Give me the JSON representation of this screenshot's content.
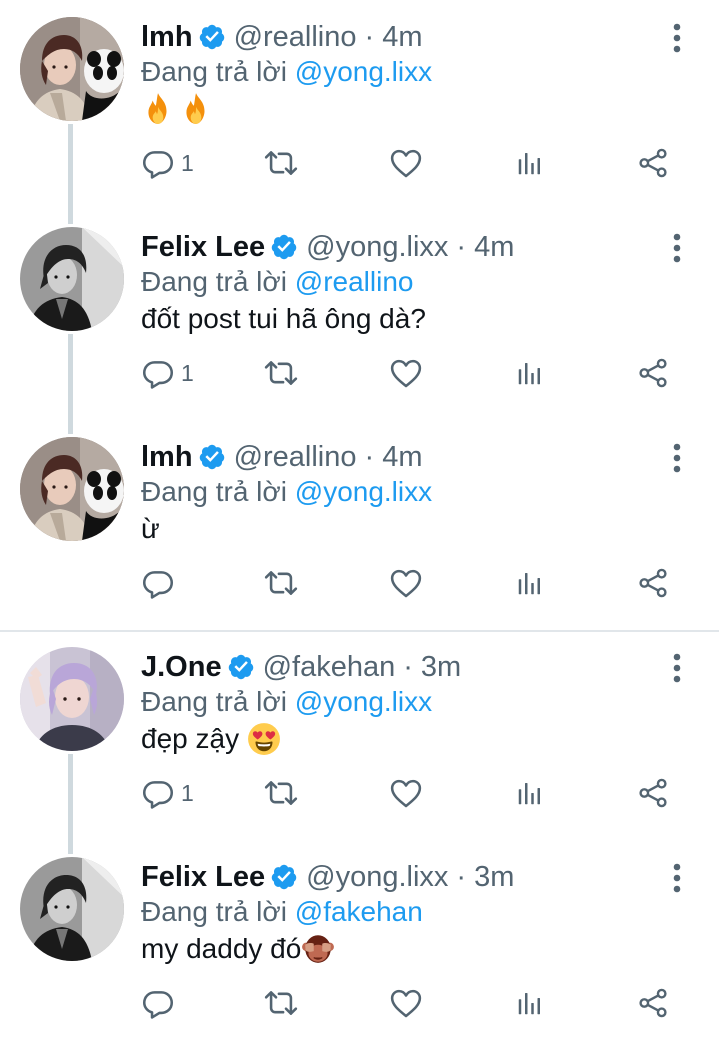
{
  "tweets": [
    {
      "name": "lmh",
      "handle": "@reallino",
      "time": "4m",
      "reply_prefix": "Đang trả lời ",
      "reply_to": "@yong.lixx",
      "text": "",
      "emoji": [
        "fire",
        "fire"
      ],
      "reply_count": "1",
      "avatar": "avatar-lmh",
      "thread_below": true
    },
    {
      "name": "Felix Lee",
      "handle": "@yong.lixx",
      "time": "4m",
      "reply_prefix": "Đang trả lời ",
      "reply_to": "@reallino",
      "text": "đốt post tui hã ông dà?",
      "emoji": [],
      "reply_count": "1",
      "avatar": "avatar-felix",
      "thread_below": true
    },
    {
      "name": "lmh",
      "handle": "@reallino",
      "time": "4m",
      "reply_prefix": "Đang trả lời ",
      "reply_to": "@yong.lixx",
      "text": "ừ",
      "emoji": [],
      "reply_count": "",
      "avatar": "avatar-lmh",
      "thread_below": false
    },
    {
      "name": "J.One",
      "handle": "@fakehan",
      "time": "3m",
      "reply_prefix": "Đang trả lời ",
      "reply_to": "@yong.lixx",
      "text": "đẹp zậy ",
      "emoji": [
        "heart-eyes"
      ],
      "reply_count": "1",
      "avatar": "avatar-jone",
      "thread_below": true
    },
    {
      "name": "Felix Lee",
      "handle": "@yong.lixx",
      "time": "3m",
      "reply_prefix": "Đang trả lời ",
      "reply_to": "@fakehan",
      "text": "my daddy đó",
      "emoji": [
        "see-no-evil-monkey"
      ],
      "reply_count": "",
      "avatar": "avatar-felix",
      "thread_below": false
    }
  ],
  "icons": {
    "reply": "reply-icon",
    "retweet": "retweet-icon",
    "like": "heart-icon",
    "views": "views-icon",
    "share": "share-icon",
    "more": "more-vertical-icon",
    "verified": "verified-badge-icon"
  },
  "colors": {
    "link": "#1d9bf0",
    "verified": "#1d9bf0",
    "secondary_text": "#536471",
    "thread_line": "#cfd9de"
  }
}
